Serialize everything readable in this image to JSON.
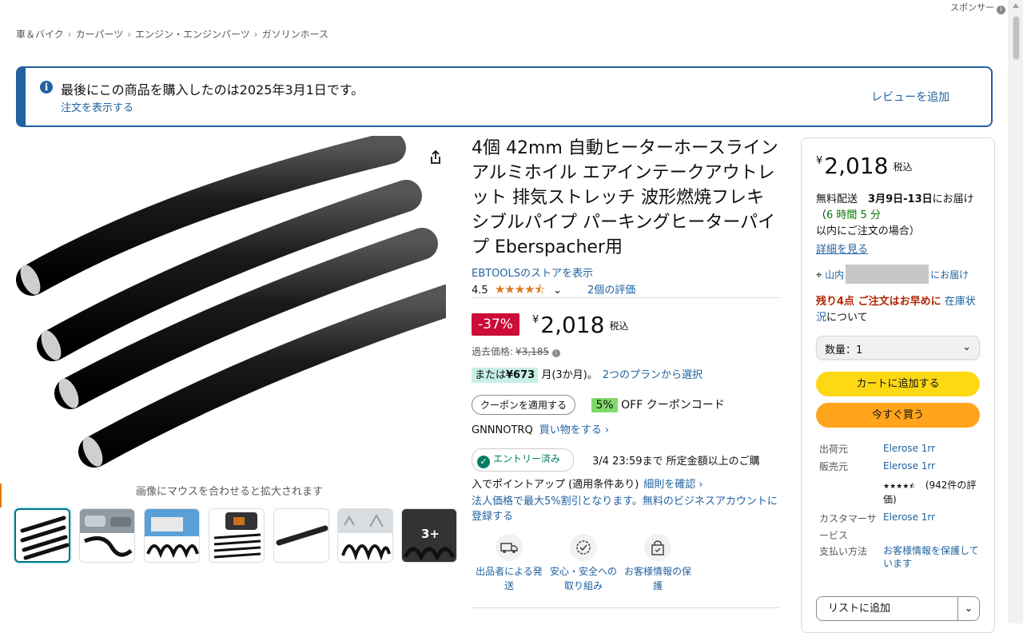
{
  "sponsored": "スポンサー",
  "breadcrumb": [
    "車＆バイク",
    "カーパーツ",
    "エンジン・エンジンパーツ",
    "ガソリンホース"
  ],
  "banner": {
    "message": "最後にこの商品を購入したのは2025年3月1日です。",
    "order_link": "注文を表示する",
    "review_link": "レビューを追加"
  },
  "gallery": {
    "zoom_hint": "画像にマウスを合わせると拡大されます",
    "more_label": "3+"
  },
  "product": {
    "title": "4個 42mm 自動ヒーターホースライン アルミホイル エアインテークアウトレット 排気ストレッチ 波形燃焼フレキシブルパイプ パーキングヒーターパイプ Eberspacher用",
    "store_link": "EBTOOLSのストアを表示",
    "rating": "4.5",
    "stars": "★★★★⯪",
    "review_count": "2個の評価",
    "discount": "-37%",
    "currency": "¥",
    "price": "2,018",
    "tax": "税込",
    "list_price_label": "過去価格:",
    "list_price": "¥3,185",
    "monthly_prefix": "または",
    "monthly_amount": "¥673",
    "monthly_suffix": "月(3か月)。",
    "plans_link": "2つのプランから選択",
    "coupon_button": "クーポンを適用する",
    "coupon_pct": "5%",
    "coupon_text": "OFF クーポンコード",
    "coupon_code": "GNNNOTRQ",
    "shop_link": "買い物をする ›",
    "entry_badge": "エントリー済み",
    "entry_text": "3/4 23:59まで 所定金額以上のご購",
    "entry_text2": "入でポイントアップ (適用条件あり)",
    "entry_link": "細則を確認 ›",
    "corporate": "法人価格で最大5%割引となります。無料のビジネスアカウントに登録する",
    "features": [
      "出品者による発送",
      "安心・安全への取り組み",
      "お客様情報の保護"
    ]
  },
  "buybox": {
    "currency": "¥",
    "price": "2,018",
    "tax": "税込",
    "delivery_prefix": "無料配送",
    "delivery_date": "3月9日-13日",
    "delivery_mid": "にお届け（",
    "delivery_time": "6 時間 5 分",
    "delivery_suffix": "以内にご注文の場合）",
    "details_link": "詳細を見る",
    "location_prefix": "山内",
    "location_suffix": "にお届け",
    "stock_warning": "残り4点 ご注文はお早めに",
    "stock_link": "在庫状況",
    "stock_suffix": "について",
    "quantity": "数量：1",
    "add_to_cart": "カートに追加する",
    "buy_now": "今すぐ買う",
    "shipper_label": "出荷元",
    "shipper": "Elerose 1rr",
    "seller_label": "販売元",
    "seller": "Elerose 1rr",
    "seller_rating": "★★★★⯪",
    "seller_reviews": "(942件の評価)",
    "cs_label": "カスタマーサービス",
    "cs_value": "Elerose 1rr",
    "payment_label": "支払い方法",
    "payment_value": "お客様情報を保護しています",
    "add_to_list": "リストに追加"
  }
}
